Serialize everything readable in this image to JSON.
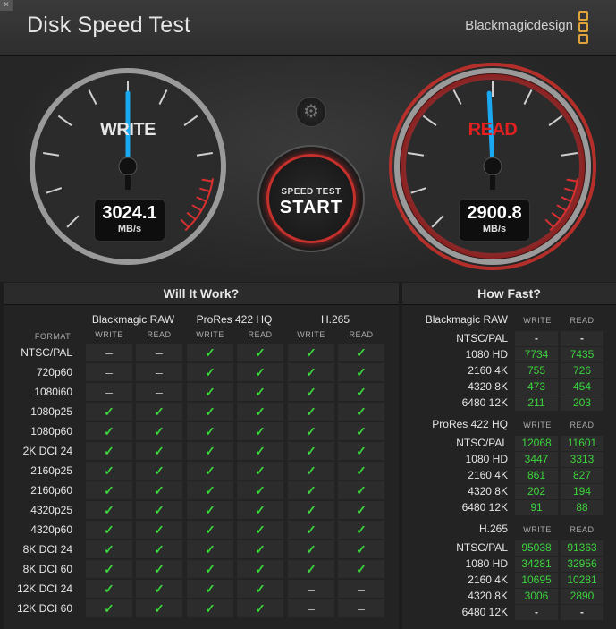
{
  "window": {
    "close_glyph": "×"
  },
  "app": {
    "title": "Disk Speed Test",
    "brand": "Blackmagicdesign"
  },
  "colors": {
    "accent_red": "#c4302b",
    "needle_blue": "#1aa8f0",
    "ok_green": "#3cd43c",
    "brand_orange": "#e0a23a"
  },
  "write_gauge": {
    "label": "WRITE",
    "value": "3024.1",
    "unit": "MB/s",
    "fraction": 0.5
  },
  "read_gauge": {
    "label": "READ",
    "value": "2900.8",
    "unit": "MB/s",
    "fraction": 0.49
  },
  "start_button": {
    "top_label": "SPEED TEST",
    "label": "START"
  },
  "settings": {
    "icon": "gear-icon",
    "glyph": "⚙"
  },
  "will_it_work": {
    "title": "Will It Work?",
    "format_header": "FORMAT",
    "codecs": [
      {
        "name": "Blackmagic RAW",
        "write": "WRITE",
        "read": "READ"
      },
      {
        "name": "ProRes 422 HQ",
        "write": "WRITE",
        "read": "READ"
      },
      {
        "name": "H.265",
        "write": "WRITE",
        "read": "READ"
      }
    ],
    "rows": [
      {
        "format": "NTSC/PAL",
        "cells": [
          "–",
          "–",
          "✓",
          "✓",
          "✓",
          "✓"
        ]
      },
      {
        "format": "720p60",
        "cells": [
          "–",
          "–",
          "✓",
          "✓",
          "✓",
          "✓"
        ]
      },
      {
        "format": "1080i60",
        "cells": [
          "–",
          "–",
          "✓",
          "✓",
          "✓",
          "✓"
        ]
      },
      {
        "format": "1080p25",
        "cells": [
          "✓",
          "✓",
          "✓",
          "✓",
          "✓",
          "✓"
        ]
      },
      {
        "format": "1080p60",
        "cells": [
          "✓",
          "✓",
          "✓",
          "✓",
          "✓",
          "✓"
        ]
      },
      {
        "format": "2K DCI 24",
        "cells": [
          "✓",
          "✓",
          "✓",
          "✓",
          "✓",
          "✓"
        ]
      },
      {
        "format": "2160p25",
        "cells": [
          "✓",
          "✓",
          "✓",
          "✓",
          "✓",
          "✓"
        ]
      },
      {
        "format": "2160p60",
        "cells": [
          "✓",
          "✓",
          "✓",
          "✓",
          "✓",
          "✓"
        ]
      },
      {
        "format": "4320p25",
        "cells": [
          "✓",
          "✓",
          "✓",
          "✓",
          "✓",
          "✓"
        ]
      },
      {
        "format": "4320p60",
        "cells": [
          "✓",
          "✓",
          "✓",
          "✓",
          "✓",
          "✓"
        ]
      },
      {
        "format": "8K DCI 24",
        "cells": [
          "✓",
          "✓",
          "✓",
          "✓",
          "✓",
          "✓"
        ]
      },
      {
        "format": "8K DCI 60",
        "cells": [
          "✓",
          "✓",
          "✓",
          "✓",
          "✓",
          "✓"
        ]
      },
      {
        "format": "12K DCI 24",
        "cells": [
          "✓",
          "✓",
          "✓",
          "✓",
          "–",
          "–"
        ]
      },
      {
        "format": "12K DCI 60",
        "cells": [
          "✓",
          "✓",
          "✓",
          "✓",
          "–",
          "–"
        ]
      }
    ]
  },
  "how_fast": {
    "title": "How Fast?",
    "sections": [
      {
        "codec": "Blackmagic RAW",
        "write": "WRITE",
        "read": "READ",
        "rows": [
          {
            "format": "NTSC/PAL",
            "write": "-",
            "read": "-"
          },
          {
            "format": "1080 HD",
            "write": "7734",
            "read": "7435"
          },
          {
            "format": "2160 4K",
            "write": "755",
            "read": "726"
          },
          {
            "format": "4320 8K",
            "write": "473",
            "read": "454"
          },
          {
            "format": "6480 12K",
            "write": "211",
            "read": "203"
          }
        ]
      },
      {
        "codec": "ProRes 422 HQ",
        "write": "WRITE",
        "read": "READ",
        "rows": [
          {
            "format": "NTSC/PAL",
            "write": "12068",
            "read": "11601"
          },
          {
            "format": "1080 HD",
            "write": "3447",
            "read": "3313"
          },
          {
            "format": "2160 4K",
            "write": "861",
            "read": "827"
          },
          {
            "format": "4320 8K",
            "write": "202",
            "read": "194"
          },
          {
            "format": "6480 12K",
            "write": "91",
            "read": "88"
          }
        ]
      },
      {
        "codec": "H.265",
        "write": "WRITE",
        "read": "READ",
        "rows": [
          {
            "format": "NTSC/PAL",
            "write": "95038",
            "read": "91363"
          },
          {
            "format": "1080 HD",
            "write": "34281",
            "read": "32956"
          },
          {
            "format": "2160 4K",
            "write": "10695",
            "read": "10281"
          },
          {
            "format": "4320 8K",
            "write": "3006",
            "read": "2890"
          },
          {
            "format": "6480 12K",
            "write": "-",
            "read": "-"
          }
        ]
      }
    ]
  }
}
